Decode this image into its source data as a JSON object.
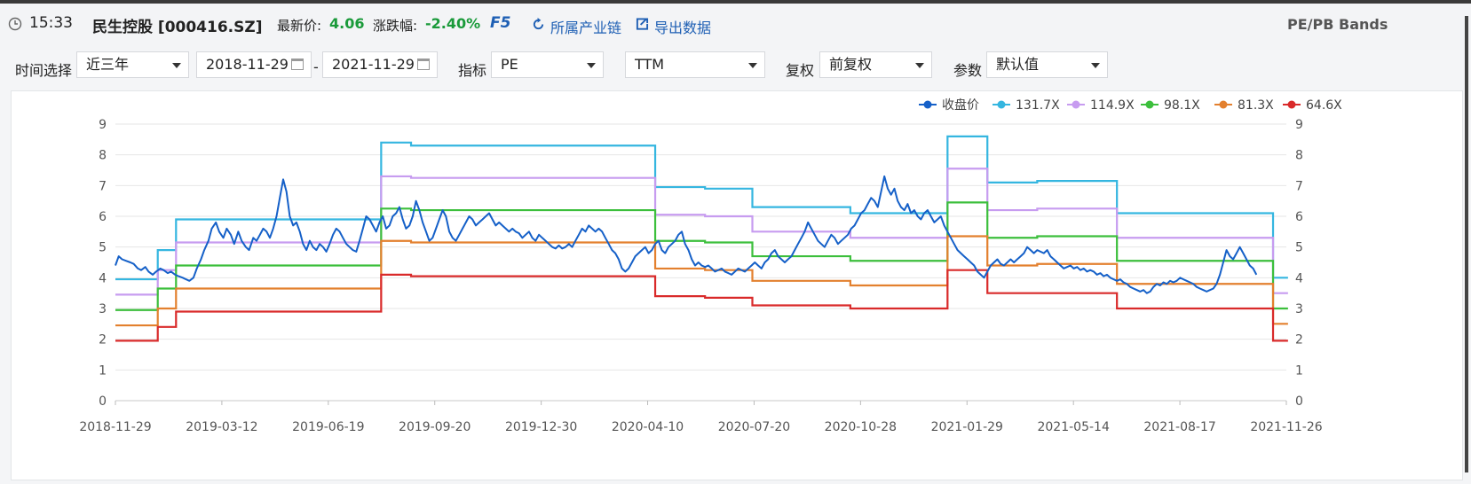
{
  "header": {
    "time": "15:33",
    "stock_name": "民生控股 [000416.SZ]",
    "price_label": "最新价:",
    "price_value": "4.06",
    "change_label": "涨跌幅:",
    "change_value": "-2.40%",
    "f5": "F5",
    "industry_chain": "所属产业链",
    "export_data": "导出数据",
    "title": "PE/PB Bands"
  },
  "toolbar": {
    "time_label": "时间选择",
    "time_value": "近三年",
    "date_from": "2018-11-29",
    "date_sep": "-",
    "date_to": "2021-11-29",
    "indicator_label": "指标",
    "indicator_value": "PE",
    "ttm_value": "TTM",
    "fq_label": "复权",
    "fq_value": "前复权",
    "param_label": "参数",
    "param_value": "默认值"
  },
  "colors": {
    "close": "#1560c8",
    "b1": "#35b6e0",
    "b2": "#c79cf0",
    "b3": "#3cbf3c",
    "b4": "#e3802e",
    "b5": "#d92a2a",
    "up": "#1a9a3a",
    "link": "#1e5fb4"
  },
  "chart_data": {
    "type": "line",
    "ylim": [
      0,
      9
    ],
    "yticks": [
      "0",
      "1",
      "2",
      "3",
      "4",
      "5",
      "6",
      "7",
      "8",
      "9"
    ],
    "xlabels": [
      "2018-11-29",
      "2019-03-12",
      "2019-06-19",
      "2019-09-20",
      "2019-12-30",
      "2020-04-10",
      "2020-07-20",
      "2020-10-28",
      "2021-01-29",
      "2021-05-14",
      "2021-08-17",
      "2021-11-26"
    ],
    "legend_position": "top-right",
    "grid": true,
    "bands_x": [
      0,
      40,
      51,
      72,
      73,
      110,
      170,
      220,
      221,
      290,
      320,
      346,
      347,
      356,
      380,
      400,
      410,
      430,
      440,
      463,
      470,
      500,
      510,
      540,
      565,
      566,
      567,
      580,
      650,
      670,
      700,
      710,
      720,
      721,
      766,
      767,
      768,
      780,
      800,
      815,
      840,
      870,
      885,
      910,
      925,
      950,
      960,
      970,
      985,
      1000,
      1002,
      1040,
      1050,
      1090,
      1100,
      1110,
      1150,
      1170,
      1175,
      1206,
      1220,
      1240,
      1250,
      1264,
      1269,
      1270,
      1290,
      1310,
      1319,
      1320,
      1330,
      1340,
      1350,
      1370,
      1380,
      1390,
      1394,
      1395,
      1400,
      1412
    ],
    "close_x": [
      0,
      4,
      8,
      13,
      18,
      22,
      27,
      31,
      36,
      40,
      45,
      49,
      54,
      58,
      63,
      67,
      72,
      76,
      81,
      85,
      89,
      94,
      98,
      103,
      107,
      112,
      116,
      121,
      125,
      130,
      134,
      139,
      143,
      148,
      152,
      157,
      161,
      166,
      170,
      174,
      178,
      182,
      186,
      190,
      194,
      198,
      202,
      206,
      210,
      214,
      218,
      222,
      226,
      230,
      234,
      238,
      242,
      246,
      250,
      254,
      258,
      262,
      266,
      270,
      274,
      278,
      282,
      286,
      290,
      294,
      298,
      302,
      306,
      310,
      314,
      318,
      322,
      326,
      330,
      334,
      338,
      342,
      346,
      350,
      354,
      358,
      362,
      366,
      370,
      374,
      378,
      382,
      386,
      390,
      394,
      398,
      402,
      406,
      410,
      414,
      418,
      422,
      426,
      430,
      434,
      438,
      442,
      446,
      450,
      454,
      458,
      462,
      466,
      470,
      474,
      478,
      482,
      486,
      490,
      494,
      498,
      502,
      506,
      510,
      514,
      518,
      522,
      526,
      530,
      534,
      538,
      542,
      546,
      550,
      554,
      558,
      562,
      566,
      570,
      574,
      578,
      582,
      586,
      590,
      594,
      598,
      602,
      606,
      610,
      614,
      618,
      622,
      626,
      630,
      634,
      638,
      642,
      646,
      650,
      654,
      658,
      662,
      666,
      670,
      674,
      678,
      682,
      686,
      690,
      694,
      698,
      702,
      706,
      710,
      714,
      718,
      722,
      726,
      730,
      734,
      738,
      742,
      746,
      750,
      754,
      758,
      762,
      766,
      770,
      774,
      778,
      782,
      786,
      790,
      794,
      798,
      802,
      806,
      810,
      814,
      818,
      822,
      826,
      830,
      834,
      838,
      842,
      846,
      850,
      854,
      858,
      862,
      866,
      870,
      874,
      878,
      882,
      886,
      890,
      894,
      898,
      902,
      906,
      910,
      914,
      918,
      922,
      926,
      930,
      934,
      938,
      942,
      946,
      950,
      954,
      958,
      962,
      966,
      970,
      974,
      978,
      982,
      986,
      990,
      994,
      998,
      1002,
      1006,
      1010,
      1014,
      1018,
      1022,
      1026,
      1030,
      1034,
      1038,
      1042,
      1046,
      1050,
      1054,
      1058,
      1062,
      1066,
      1070,
      1074,
      1078,
      1082,
      1086,
      1090,
      1094,
      1098,
      1102,
      1106,
      1110,
      1114,
      1118,
      1122,
      1126,
      1130,
      1134,
      1138,
      1142,
      1146,
      1150,
      1154,
      1158,
      1162,
      1166,
      1170,
      1174,
      1178,
      1182,
      1186,
      1190,
      1194,
      1198,
      1202,
      1206,
      1210,
      1214,
      1218,
      1222,
      1226,
      1230,
      1234,
      1238,
      1242,
      1246,
      1250,
      1254,
      1258,
      1262,
      1266,
      1270,
      1274,
      1278,
      1282,
      1286,
      1290,
      1294,
      1298,
      1302,
      1306,
      1310,
      1314,
      1318,
      1322,
      1326,
      1330,
      1334,
      1338,
      1342,
      1346,
      1350,
      1354,
      1358,
      1362,
      1366,
      1370,
      1374,
      1378,
      1382,
      1386,
      1390,
      1394,
      1398,
      1402,
      1406,
      1410
    ],
    "series": [
      {
        "name": "收盘价",
        "values": [
          4.4,
          4.7,
          4.6,
          4.55,
          4.5,
          4.45,
          4.3,
          4.25,
          4.35,
          4.2,
          4.1,
          4.2,
          4.3,
          4.25,
          4.15,
          4.2,
          4.1,
          4.05,
          4.0,
          3.95,
          3.9,
          4.0,
          4.3,
          4.6,
          4.9,
          5.2,
          5.6,
          5.8,
          5.5,
          5.3,
          5.6,
          5.4,
          5.1,
          5.5,
          5.2,
          5.0,
          4.9,
          5.3,
          5.2,
          5.4,
          5.6,
          5.5,
          5.3,
          5.6,
          6.0,
          6.6,
          7.2,
          6.8,
          6.0,
          5.7,
          5.8,
          5.5,
          5.1,
          4.9,
          5.2,
          5.0,
          4.9,
          5.1,
          5.0,
          4.85,
          5.1,
          5.4,
          5.6,
          5.5,
          5.3,
          5.1,
          5.0,
          4.9,
          4.85,
          5.2,
          5.6,
          6.0,
          5.9,
          5.7,
          5.5,
          5.8,
          6.0,
          5.6,
          5.7,
          6.0,
          6.1,
          6.3,
          5.9,
          5.6,
          5.7,
          6.0,
          6.5,
          6.2,
          5.8,
          5.5,
          5.2,
          5.3,
          5.6,
          5.9,
          6.2,
          6.0,
          5.5,
          5.3,
          5.2,
          5.4,
          5.6,
          5.8,
          6.0,
          5.9,
          5.7,
          5.8,
          5.9,
          6.0,
          6.1,
          5.9,
          5.7,
          5.8,
          5.7,
          5.6,
          5.5,
          5.6,
          5.5,
          5.45,
          5.3,
          5.4,
          5.5,
          5.3,
          5.2,
          5.4,
          5.3,
          5.2,
          5.1,
          5.0,
          4.95,
          5.05,
          4.95,
          5.0,
          5.1,
          5.0,
          5.2,
          5.4,
          5.6,
          5.5,
          5.7,
          5.6,
          5.5,
          5.6,
          5.5,
          5.3,
          5.1,
          4.9,
          4.8,
          4.6,
          4.3,
          4.2,
          4.3,
          4.5,
          4.7,
          4.8,
          4.9,
          5.0,
          4.8,
          4.9,
          5.1,
          5.2,
          4.9,
          4.8,
          5.0,
          5.1,
          5.2,
          5.4,
          5.5,
          5.1,
          4.9,
          4.6,
          4.4,
          4.5,
          4.4,
          4.35,
          4.4,
          4.3,
          4.2,
          4.25,
          4.3,
          4.2,
          4.15,
          4.1,
          4.2,
          4.3,
          4.25,
          4.2,
          4.3,
          4.4,
          4.5,
          4.4,
          4.3,
          4.5,
          4.6,
          4.8,
          4.9,
          4.7,
          4.6,
          4.5,
          4.6,
          4.7,
          4.9,
          5.1,
          5.3,
          5.5,
          5.8,
          5.6,
          5.4,
          5.2,
          5.1,
          5.0,
          5.2,
          5.4,
          5.3,
          5.1,
          5.2,
          5.3,
          5.4,
          5.6,
          5.7,
          5.9,
          6.1,
          6.2,
          6.4,
          6.6,
          6.5,
          6.3,
          6.8,
          7.3,
          6.9,
          6.7,
          6.9,
          6.5,
          6.3,
          6.2,
          6.4,
          6.1,
          6.2,
          6.0,
          5.9,
          6.1,
          6.2,
          6.0,
          5.8,
          5.9,
          6.0,
          5.7,
          5.5,
          5.3,
          5.1,
          4.9,
          4.8,
          4.7,
          4.6,
          4.5,
          4.4,
          4.2,
          4.1,
          4.0,
          4.2,
          4.4,
          4.5,
          4.6,
          4.45,
          4.4,
          4.5,
          4.6,
          4.5,
          4.6,
          4.7,
          4.8,
          5.0,
          4.9,
          4.8,
          4.9,
          4.85,
          4.8,
          4.9,
          4.7,
          4.6,
          4.5,
          4.4,
          4.3,
          4.35,
          4.4,
          4.3,
          4.35,
          4.25,
          4.3,
          4.2,
          4.25,
          4.2,
          4.1,
          4.15,
          4.05,
          4.1,
          4.0,
          3.95,
          3.9,
          3.95,
          3.85,
          3.8,
          3.7,
          3.65,
          3.6,
          3.55,
          3.6,
          3.5,
          3.55,
          3.7,
          3.8,
          3.75,
          3.85,
          3.8,
          3.9,
          3.85,
          3.9,
          4.0,
          3.95,
          3.9,
          3.85,
          3.8,
          3.7,
          3.65,
          3.6,
          3.55,
          3.6,
          3.65,
          3.8,
          4.1,
          4.5,
          4.9,
          4.7,
          4.6,
          4.8,
          5.0,
          4.8,
          4.6,
          4.4,
          4.3,
          4.1
        ]
      },
      {
        "name": "131.7X",
        "values": [
          3.95,
          3.95,
          4.9,
          4.9,
          5.9,
          5.9,
          5.9,
          5.9,
          5.9,
          5.9,
          8.4,
          8.4,
          8.4,
          8.3,
          8.3,
          8.3,
          8.3,
          8.3,
          8.3,
          8.3,
          8.3,
          8.3,
          8.3,
          8.3,
          8.3,
          8.3,
          8.3,
          8.3,
          6.95,
          6.95,
          6.95,
          6.9,
          6.9,
          6.9,
          6.9,
          6.3,
          6.3,
          6.3,
          6.3,
          6.3,
          6.3,
          6.3,
          6.1,
          6.1,
          6.1,
          6.1,
          6.1,
          6.1,
          6.1,
          6.1,
          8.6,
          8.6,
          7.1,
          7.1,
          7.1,
          7.15,
          7.15,
          7.15,
          7.15,
          6.1,
          6.1,
          6.1,
          6.1,
          6.1,
          6.1,
          6.1,
          6.1,
          6.1,
          6.1,
          6.1,
          6.1,
          6.1,
          6.1,
          6.1,
          6.1,
          6.1,
          4.0,
          4.0,
          4.0,
          4.0
        ]
      },
      {
        "name": "114.9X",
        "values": [
          3.45,
          3.45,
          4.25,
          4.25,
          5.15,
          5.15,
          5.15,
          5.15,
          5.15,
          5.15,
          7.3,
          7.3,
          7.3,
          7.25,
          7.25,
          7.25,
          7.25,
          7.25,
          7.25,
          7.25,
          7.25,
          7.25,
          7.25,
          7.25,
          7.25,
          7.25,
          7.25,
          7.25,
          6.05,
          6.05,
          6.05,
          6.0,
          6.0,
          6.0,
          6.0,
          5.5,
          5.5,
          5.5,
          5.5,
          5.5,
          5.5,
          5.5,
          5.3,
          5.3,
          5.3,
          5.3,
          5.3,
          5.3,
          5.3,
          5.3,
          7.55,
          7.55,
          6.2,
          6.2,
          6.2,
          6.25,
          6.25,
          6.25,
          6.25,
          5.3,
          5.3,
          5.3,
          5.3,
          5.3,
          5.3,
          5.3,
          5.3,
          5.3,
          5.3,
          5.3,
          5.3,
          5.3,
          5.3,
          5.3,
          5.3,
          5.3,
          3.5,
          3.5,
          3.5,
          3.5
        ]
      },
      {
        "name": "98.1X",
        "values": [
          2.95,
          2.95,
          3.65,
          3.65,
          4.4,
          4.4,
          4.4,
          4.4,
          4.4,
          4.4,
          6.25,
          6.25,
          6.25,
          6.2,
          6.2,
          6.2,
          6.2,
          6.2,
          6.2,
          6.2,
          6.2,
          6.2,
          6.2,
          6.2,
          6.2,
          6.2,
          6.2,
          6.2,
          5.2,
          5.2,
          5.2,
          5.15,
          5.15,
          5.15,
          5.15,
          4.7,
          4.7,
          4.7,
          4.7,
          4.7,
          4.7,
          4.7,
          4.55,
          4.55,
          4.55,
          4.55,
          4.55,
          4.55,
          4.55,
          4.55,
          6.45,
          6.45,
          5.3,
          5.3,
          5.3,
          5.35,
          5.35,
          5.35,
          5.35,
          4.55,
          4.55,
          4.55,
          4.55,
          4.55,
          4.55,
          4.55,
          4.55,
          4.55,
          4.55,
          4.55,
          4.55,
          4.55,
          4.55,
          4.55,
          4.55,
          4.55,
          3.0,
          3.0,
          3.0,
          3.0
        ]
      },
      {
        "name": "81.3X",
        "values": [
          2.45,
          2.45,
          3.0,
          3.0,
          3.65,
          3.65,
          3.65,
          3.65,
          3.65,
          3.65,
          5.2,
          5.2,
          5.2,
          5.15,
          5.15,
          5.15,
          5.15,
          5.15,
          5.15,
          5.15,
          5.15,
          5.15,
          5.15,
          5.15,
          5.15,
          5.15,
          5.15,
          5.15,
          4.3,
          4.3,
          4.3,
          4.25,
          4.25,
          4.25,
          4.25,
          3.9,
          3.9,
          3.9,
          3.9,
          3.9,
          3.9,
          3.9,
          3.75,
          3.75,
          3.75,
          3.75,
          3.75,
          3.75,
          3.75,
          3.75,
          5.35,
          5.35,
          4.4,
          4.4,
          4.4,
          4.45,
          4.45,
          4.45,
          4.45,
          3.8,
          3.8,
          3.8,
          3.8,
          3.8,
          3.8,
          3.8,
          3.8,
          3.8,
          3.8,
          3.8,
          3.8,
          3.8,
          3.8,
          3.8,
          3.8,
          3.8,
          2.5,
          2.5,
          2.5,
          2.5
        ]
      },
      {
        "name": "64.6X",
        "values": [
          1.95,
          1.95,
          2.4,
          2.4,
          2.9,
          2.9,
          2.9,
          2.9,
          2.9,
          2.9,
          4.1,
          4.1,
          4.1,
          4.05,
          4.05,
          4.05,
          4.05,
          4.05,
          4.05,
          4.05,
          4.05,
          4.05,
          4.05,
          4.05,
          4.05,
          4.05,
          4.05,
          4.05,
          3.4,
          3.4,
          3.4,
          3.35,
          3.35,
          3.35,
          3.35,
          3.1,
          3.1,
          3.1,
          3.1,
          3.1,
          3.1,
          3.1,
          3.0,
          3.0,
          3.0,
          3.0,
          3.0,
          3.0,
          3.0,
          3.0,
          4.25,
          4.25,
          3.5,
          3.5,
          3.5,
          3.5,
          3.5,
          3.5,
          3.5,
          3.0,
          3.0,
          3.0,
          3.0,
          3.0,
          3.0,
          3.0,
          3.0,
          3.0,
          3.0,
          3.0,
          3.0,
          3.0,
          3.0,
          3.0,
          3.0,
          3.0,
          1.95,
          1.95,
          1.95,
          1.95
        ]
      }
    ]
  }
}
